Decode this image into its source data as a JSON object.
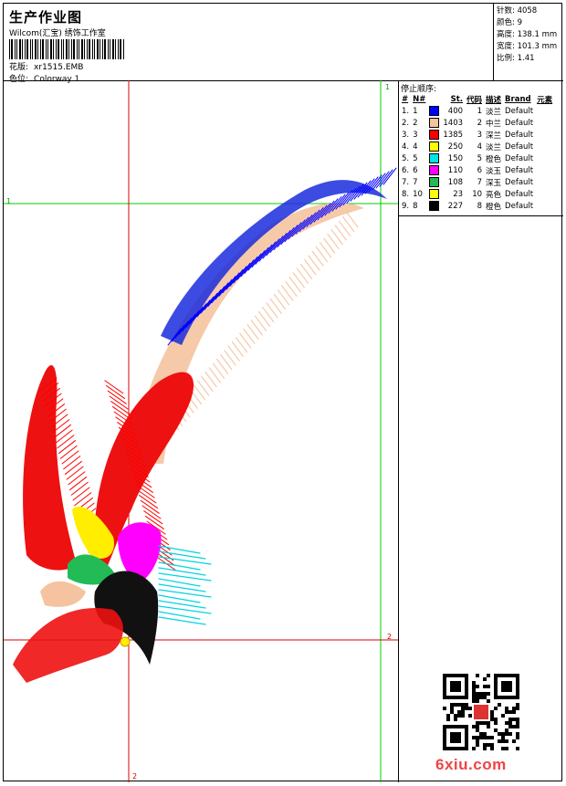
{
  "header": {
    "title": "生产作业图",
    "company": "Wilcom(汇宝) 绣饰工作室",
    "design_label": "花版:",
    "design_value": "xr1515.EMB",
    "colorway_label": "色位:",
    "colorway_value": "Colorway 1"
  },
  "stats": [
    {
      "label": "针数:",
      "value": "4058"
    },
    {
      "label": "颜色:",
      "value": "9"
    },
    {
      "label": "高度:",
      "value": "138.1 mm"
    },
    {
      "label": "宽度:",
      "value": "101.3 mm"
    },
    {
      "label": "比例:",
      "value": "1.41"
    }
  ],
  "stop_sequence": {
    "heading": "停止顺序:",
    "columns": [
      "#",
      "N#",
      "St.",
      "代码",
      "描述",
      "Brand",
      "元素"
    ],
    "rows": [
      {
        "idx": "1.",
        "n": "1",
        "color": "#0000ff",
        "st": "400",
        "code": "1",
        "desc": "淡兰",
        "brand": "Default"
      },
      {
        "idx": "2.",
        "n": "2",
        "color": "#f5c3a0",
        "st": "1403",
        "code": "2",
        "desc": "中兰",
        "brand": "Default"
      },
      {
        "idx": "3.",
        "n": "3",
        "color": "#ff0000",
        "st": "1385",
        "code": "3",
        "desc": "深兰",
        "brand": "Default"
      },
      {
        "idx": "4.",
        "n": "4",
        "color": "#ffff00",
        "st": "250",
        "code": "4",
        "desc": "淡兰",
        "brand": "Default"
      },
      {
        "idx": "5.",
        "n": "5",
        "color": "#00e5e5",
        "st": "150",
        "code": "5",
        "desc": "橙色",
        "brand": "Default"
      },
      {
        "idx": "6.",
        "n": "6",
        "color": "#ff00ff",
        "st": "110",
        "code": "6",
        "desc": "淡玉",
        "brand": "Default"
      },
      {
        "idx": "7.",
        "n": "7",
        "color": "#22bb55",
        "st": "108",
        "code": "7",
        "desc": "深玉",
        "brand": "Default"
      },
      {
        "idx": "8.",
        "n": "10",
        "color": "#ffff00",
        "st": "23",
        "code": "10",
        "desc": "亮色",
        "brand": "Default"
      },
      {
        "idx": "9.",
        "n": "8",
        "color": "#000000",
        "st": "227",
        "code": "8",
        "desc": "橙色",
        "brand": "Default"
      }
    ]
  },
  "guides": {
    "top_label": "1",
    "left_label": "1",
    "right_label": "2",
    "bottom_label": "2"
  },
  "watermark": "6xiu.com"
}
